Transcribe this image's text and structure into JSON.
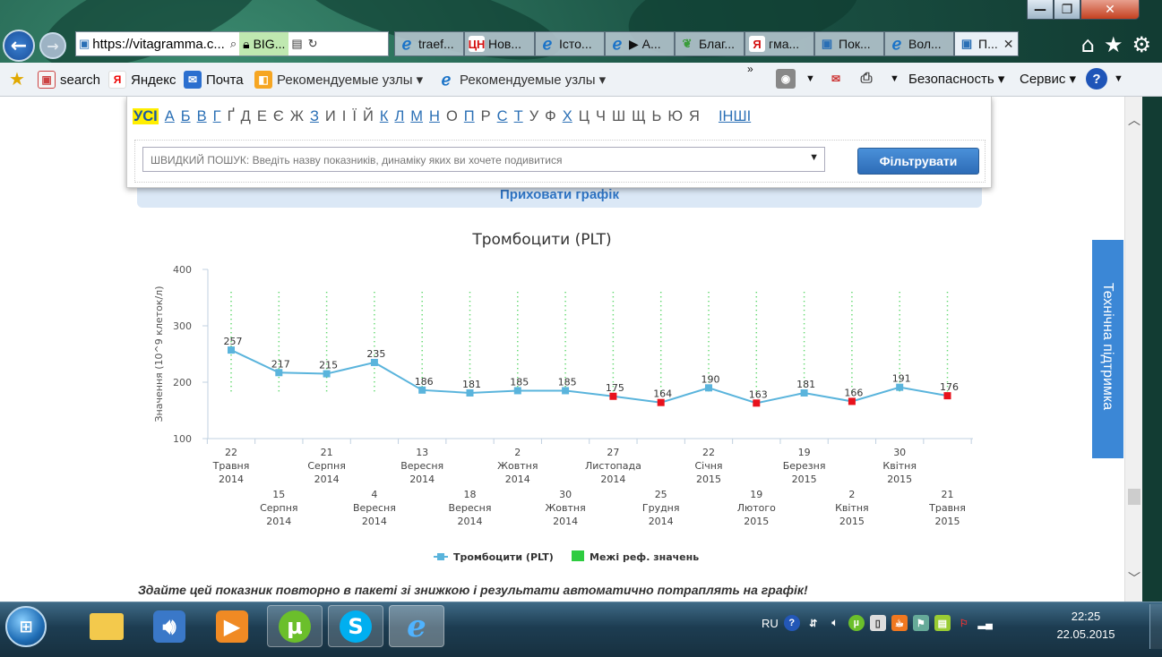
{
  "window": {
    "minimize_glyph": "—",
    "maximize_glyph": "❐",
    "close_glyph": "✕"
  },
  "browser": {
    "address_text": "https://vitagramma.c...",
    "site_badge": "BIG...",
    "tabs": [
      {
        "label": "traef...",
        "icon": "ie-icon"
      },
      {
        "label": "Нов...",
        "icon_text": "ЦН"
      },
      {
        "label": "Істо...",
        "icon": "ie-icon"
      },
      {
        "label": "▶ А...",
        "icon": "ie-icon"
      },
      {
        "label": "Благ...",
        "icon": "leaf-icon"
      },
      {
        "label": "гма...",
        "icon_text": "Я"
      },
      {
        "label": "Пок...",
        "icon": "vitagramma-icon"
      },
      {
        "label": "Вол...",
        "icon": "ie-icon"
      },
      {
        "label": "П...",
        "icon": "vitagramma-icon",
        "active": true
      }
    ]
  },
  "favorites": {
    "items": [
      {
        "label": "search"
      },
      {
        "label": "Яндекс",
        "icon_text": "Я"
      },
      {
        "label": "Почта"
      },
      {
        "label": "Рекомендуемые узлы ▾"
      },
      {
        "label": "Рекомендуемые узлы ▾"
      }
    ],
    "overflow": "»",
    "commands": [
      "Безопасность ▾",
      "Сервис ▾"
    ]
  },
  "filter": {
    "all_label": "УСІ",
    "letters": [
      {
        "l": "А",
        "link": true
      },
      {
        "l": "Б",
        "link": true
      },
      {
        "l": "В",
        "link": true
      },
      {
        "l": "Г",
        "link": true
      },
      {
        "l": "Ґ",
        "link": false
      },
      {
        "l": "Д",
        "link": false
      },
      {
        "l": "Е",
        "link": false
      },
      {
        "l": "Є",
        "link": false
      },
      {
        "l": "Ж",
        "link": false
      },
      {
        "l": "З",
        "link": true
      },
      {
        "l": "И",
        "link": false
      },
      {
        "l": "І",
        "link": false
      },
      {
        "l": "Ї",
        "link": false
      },
      {
        "l": "Й",
        "link": false
      },
      {
        "l": "К",
        "link": true
      },
      {
        "l": "Л",
        "link": true
      },
      {
        "l": "М",
        "link": true
      },
      {
        "l": "Н",
        "link": true
      },
      {
        "l": "О",
        "link": false
      },
      {
        "l": "П",
        "link": true
      },
      {
        "l": "Р",
        "link": false
      },
      {
        "l": "С",
        "link": true
      },
      {
        "l": "Т",
        "link": true
      },
      {
        "l": "У",
        "link": false
      },
      {
        "l": "Ф",
        "link": false
      },
      {
        "l": "Х",
        "link": true
      },
      {
        "l": "Ц",
        "link": false
      },
      {
        "l": "Ч",
        "link": false
      },
      {
        "l": "Ш",
        "link": false
      },
      {
        "l": "Щ",
        "link": false
      },
      {
        "l": "Ь",
        "link": false
      },
      {
        "l": "Ю",
        "link": false
      },
      {
        "l": "Я",
        "link": false
      }
    ],
    "other_label": "ІНШІ",
    "search_placeholder": "ШВИДКИЙ ПОШУК: Введіть назву показників, динаміку яких ви хочете подивитися",
    "button_label": "Фільтрувати"
  },
  "hide_chart_label": "Приховати графік",
  "support_label": "Технічна підтримка",
  "notice_text": "Здайте цей показник повторно в пакеті зі знижкою і результати автоматично потраплять на графік!",
  "chart_data": {
    "type": "line",
    "title": "Тромбоцити (PLT)",
    "ylabel": "Значення (10^9 клеток/л)",
    "ylim": [
      100,
      400
    ],
    "yticks": [
      100,
      200,
      300,
      400
    ],
    "x": [
      [
        "22",
        "Травня",
        "2014"
      ],
      [
        "15",
        "Серпня",
        "2014"
      ],
      [
        "21",
        "Серпня",
        "2014"
      ],
      [
        "4",
        "Вересня",
        "2014"
      ],
      [
        "13",
        "Вересня",
        "2014"
      ],
      [
        "18",
        "Вересня",
        "2014"
      ],
      [
        "2",
        "Жовтня",
        "2014"
      ],
      [
        "30",
        "Жовтня",
        "2014"
      ],
      [
        "27",
        "Листопада",
        "2014"
      ],
      [
        "25",
        "Грудня",
        "2014"
      ],
      [
        "22",
        "Січня",
        "2015"
      ],
      [
        "19",
        "Лютого",
        "2015"
      ],
      [
        "19",
        "Березня",
        "2015"
      ],
      [
        "2",
        "Квітня",
        "2015"
      ],
      [
        "30",
        "Квітня",
        "2015"
      ],
      [
        "21",
        "Травня",
        "2015"
      ]
    ],
    "series": [
      {
        "name": "Тромбоцити (PLT)",
        "color": "#5ab4dc",
        "values": [
          257,
          217,
          215,
          235,
          186,
          181,
          185,
          185,
          175,
          164,
          190,
          163,
          181,
          166,
          191,
          176
        ],
        "out_of_range": [
          false,
          false,
          false,
          false,
          false,
          false,
          false,
          false,
          true,
          true,
          false,
          true,
          false,
          true,
          false,
          true
        ]
      },
      {
        "name": "Межі реф. значень",
        "color": "#2ecc40",
        "range": [
          180,
          360
        ]
      }
    ],
    "out_of_range_color": "#e8121c",
    "grid": false,
    "legend": "bottom"
  },
  "taskbar": {
    "start_label": "⊞",
    "apps": [
      "explorer-icon",
      "media-icon",
      "player-icon",
      "utorrent-icon",
      "skype-icon",
      "ie-icon"
    ],
    "tray_lang": "RU",
    "clock_time": "22:25",
    "clock_date": "22.05.2015"
  }
}
